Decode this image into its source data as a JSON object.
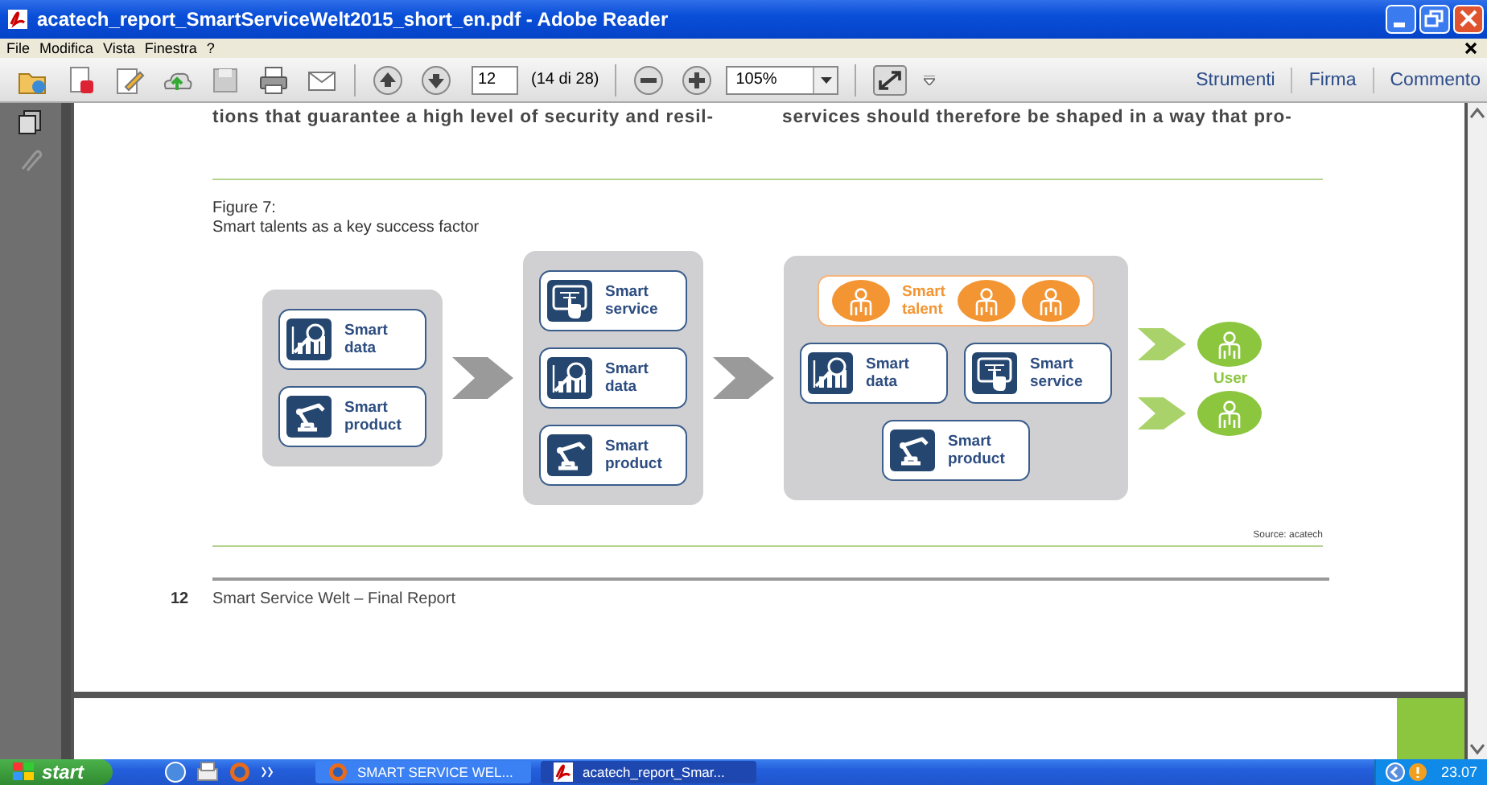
{
  "window": {
    "title": "acatech_report_SmartServiceWelt2015_short_en.pdf - Adobe Reader"
  },
  "menu": [
    "File",
    "Modifica",
    "Vista",
    "Finestra",
    "?"
  ],
  "toolbar": {
    "page": "12",
    "page_count": "(14 di 28)",
    "zoom": "105%",
    "panels": [
      "Strumenti",
      "Firma",
      "Commento"
    ]
  },
  "document": {
    "body_columns": [
      "tions that guarantee a high level of security and resil-",
      "services should therefore be shaped in a way that pro-"
    ],
    "figure_label": "Figure 7:",
    "figure_caption": "Smart talents as a key success factor",
    "diagram": {
      "groups": [
        {
          "rows": [
            [
              {
                "kind": "data",
                "label": "Smart data"
              }
            ],
            [
              {
                "kind": "product",
                "label": "Smart product"
              }
            ]
          ]
        },
        {
          "rows": [
            [
              {
                "kind": "service",
                "label": "Smart service"
              }
            ],
            [
              {
                "kind": "data",
                "label": "Smart data"
              }
            ],
            [
              {
                "kind": "product",
                "label": "Smart product"
              }
            ]
          ]
        },
        {
          "talent": {
            "label": "Smart talent"
          },
          "rows": [
            [
              {
                "kind": "data",
                "label": "Smart data"
              },
              {
                "kind": "service",
                "label": "Smart service"
              }
            ],
            [
              {
                "kind": "product",
                "label": "Smart product"
              }
            ]
          ]
        }
      ],
      "user_label": "User"
    },
    "source": "Source: acatech",
    "page_number": "12",
    "footer": "Smart Service Welt – Final Report"
  },
  "taskbar": {
    "start": "start",
    "tasks": [
      {
        "label": "SMART SERVICE WEL...",
        "selected": false
      },
      {
        "label": "acatech_report_Smar...",
        "selected": true
      }
    ],
    "clock": "23.07"
  }
}
